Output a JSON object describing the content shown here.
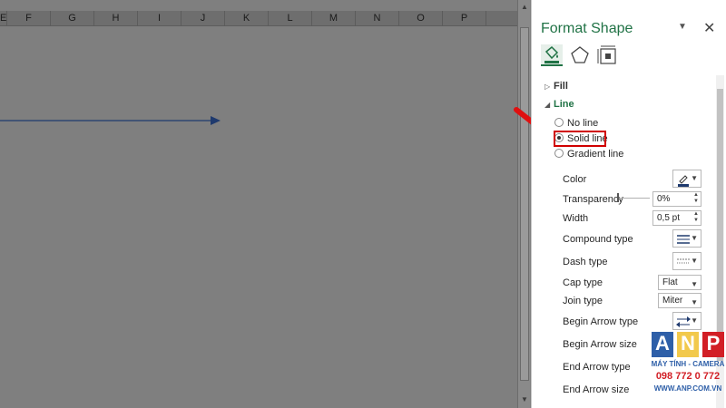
{
  "sheet": {
    "columns": [
      "E",
      "F",
      "G",
      "H",
      "I",
      "J",
      "K",
      "L",
      "M",
      "N",
      "O",
      "P"
    ]
  },
  "pane": {
    "title": "Format Shape",
    "tabs": [
      {
        "icon": "fill-line-icon"
      },
      {
        "icon": "effects-pentagon-icon"
      },
      {
        "icon": "size-properties-icon"
      }
    ],
    "sections": {
      "fill": "Fill",
      "line": "Line"
    },
    "line_options": [
      "No line",
      "Solid line",
      "Gradient line"
    ],
    "selected_line_option": "Solid line",
    "properties": {
      "color": "Color",
      "transparency": "Transparency",
      "transparency_value": "0%",
      "width": "Width",
      "width_value": "0,5 pt",
      "compound_type": "Compound type",
      "dash_type": "Dash type",
      "cap_type": "Cap type",
      "cap_type_value": "Flat",
      "join_type": "Join type",
      "join_type_value": "Miter",
      "begin_arrow_type": "Begin Arrow type",
      "begin_arrow_size": "Begin Arrow size",
      "end_arrow_type": "End Arrow type",
      "end_arrow_size": "End Arrow size"
    }
  },
  "watermark": {
    "logo": "ANP",
    "line1": "MÁY TÍNH - CAMERA",
    "phone": "098 772 0 772",
    "site": "WWW.ANP.COM.VN"
  },
  "colors": {
    "accent": "#217346",
    "highlight": "#d00000",
    "arrow_line": "#1f3a6e",
    "watermark_blue": "#2e5fa8",
    "watermark_red": "#d21f26"
  }
}
